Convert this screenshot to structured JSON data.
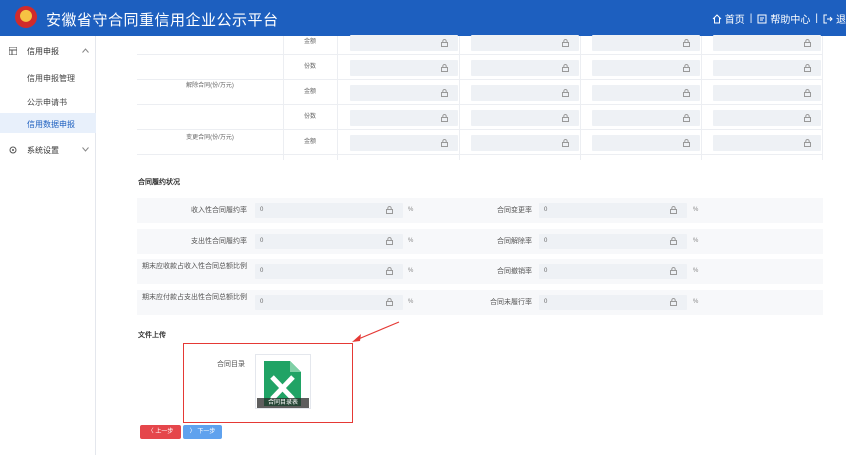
{
  "header": {
    "title": "安徽省守合同重信用企业公示平台",
    "nav": {
      "home": "首页",
      "help": "帮助中心",
      "logout": "退"
    }
  },
  "sidebar": {
    "group1": {
      "label": "信用申报"
    },
    "items": [
      {
        "label": "信用申报管理"
      },
      {
        "label": "公示申请书"
      },
      {
        "label": "信用数据申报"
      }
    ],
    "group2": {
      "label": "系统设置"
    }
  },
  "amount_table": {
    "rows": [
      {
        "label": "",
        "sub": "金额"
      },
      {
        "label": "解除合同(份/万元)",
        "sub": "份数"
      },
      {
        "label": "",
        "sub": "金额"
      },
      {
        "label": "变更合同(份/万元)",
        "sub": "份数"
      },
      {
        "label": "",
        "sub": "金额"
      }
    ]
  },
  "performance": {
    "title": "合同履约状况",
    "rows": [
      {
        "left_label": "收入性合同履约率",
        "left_value": "0",
        "right_label": "合同变更率",
        "right_value": "0",
        "unit": "%"
      },
      {
        "left_label": "支出性合同履约率",
        "left_value": "0",
        "right_label": "合同解除率",
        "right_value": "0",
        "unit": "%"
      },
      {
        "left_label": "期末应收款占收入性合同总额比例",
        "left_value": "0",
        "right_label": "合同撤销率",
        "right_value": "0",
        "unit": "%"
      },
      {
        "left_label": "期末应付款占支出性合同总额比例",
        "left_value": "0",
        "right_label": "合同未履行率",
        "right_value": "0",
        "unit": "%"
      }
    ]
  },
  "upload": {
    "title": "文件上传",
    "label": "合同目录",
    "file_name": "合同目录表"
  },
  "buttons": {
    "prev": "〈 上一步",
    "next": "〉 下一步"
  },
  "colors": {
    "header": "#1d5fbf",
    "highlight": "#e53935",
    "prev": "#e5464b",
    "next": "#5fa2ee"
  }
}
